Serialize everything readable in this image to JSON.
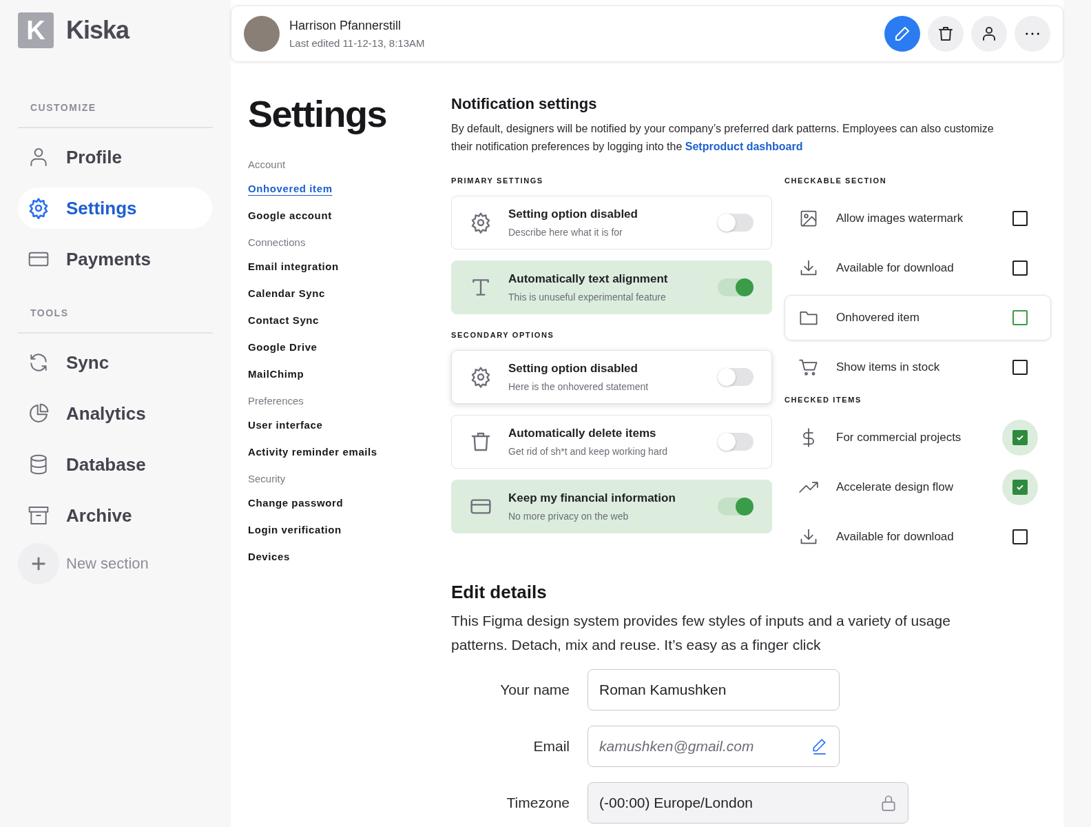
{
  "sidebar": {
    "logo_letter": "K",
    "brand": "Kiska",
    "sections": [
      {
        "title": "CUSTOMIZE",
        "items": [
          {
            "label": "Profile",
            "kind": "person",
            "selected": false
          },
          {
            "label": "Settings",
            "kind": "gear",
            "selected": true
          },
          {
            "label": "Payments",
            "kind": "card",
            "selected": false
          }
        ]
      },
      {
        "title": "TOOLS",
        "items": [
          {
            "label": "Sync",
            "kind": "sync",
            "selected": false
          },
          {
            "label": "Analytics",
            "kind": "pie",
            "selected": false
          },
          {
            "label": "Database",
            "kind": "database",
            "selected": false
          },
          {
            "label": "Archive",
            "kind": "archive",
            "selected": false
          }
        ]
      }
    ],
    "new_section": "New section"
  },
  "header": {
    "name": "Harrison Pfannerstill",
    "subtitle": "Last edited 11-12-13, 8:13AM",
    "actions": [
      {
        "kind": "edit",
        "selected": true
      },
      {
        "kind": "delete",
        "selected": false
      },
      {
        "kind": "person",
        "selected": false
      },
      {
        "kind": "more",
        "selected": false
      }
    ]
  },
  "settings_nav": {
    "title": "Settings",
    "groups": [
      {
        "heading": "Account",
        "items": [
          {
            "label": "Onhovered item",
            "selected": true
          },
          {
            "label": "Google account",
            "selected": false
          }
        ]
      },
      {
        "heading": "Connections",
        "items": [
          {
            "label": "Email integration",
            "selected": false
          },
          {
            "label": "Calendar Sync",
            "selected": false
          },
          {
            "label": "Contact Sync",
            "selected": false
          },
          {
            "label": "Google Drive",
            "selected": false
          },
          {
            "label": "MailChimp",
            "selected": false
          }
        ]
      },
      {
        "heading": "Preferences",
        "items": [
          {
            "label": "User interface",
            "selected": false
          },
          {
            "label": "Activity reminder emails",
            "selected": false
          }
        ]
      },
      {
        "heading": "Security",
        "items": [
          {
            "label": "Change password",
            "selected": false
          },
          {
            "label": "Login verification",
            "selected": false
          },
          {
            "label": "Devices",
            "selected": false
          }
        ]
      }
    ]
  },
  "notifications": {
    "title": "Notification settings",
    "description": "By default, designers will be notified by your company’s preferred dark patterns. Employees can also customize their notification preferences by logging into the",
    "link": "Setproduct dashboard",
    "toggle_groups": [
      {
        "heading": "PRIMARY SETTINGS",
        "items": [
          {
            "kind": "gear",
            "title": "Setting option disabled",
            "subtitle": "Describe here what it is for",
            "on": false,
            "hovered": false
          },
          {
            "kind": "text",
            "title": "Automatically text alignment",
            "subtitle": "This is unuseful experimental feature",
            "on": true,
            "hovered": false
          }
        ]
      },
      {
        "heading": "SECONDARY OPTIONS",
        "items": [
          {
            "kind": "gear",
            "title": "Setting option disabled",
            "subtitle": "Here is the onhovered statement",
            "on": false,
            "hovered": true
          },
          {
            "kind": "trash",
            "title": "Automatically delete items",
            "subtitle": "Get rid of sh*t and keep working hard",
            "on": false,
            "hovered": false
          },
          {
            "kind": "card",
            "title": "Keep my financial information",
            "subtitle": "No more privacy on the web",
            "on": true,
            "hovered": false
          }
        ]
      }
    ],
    "check_groups": [
      {
        "heading": "CHECKABLE SECTION",
        "items": [
          {
            "kind": "image",
            "label": "Allow images watermark",
            "checked": false,
            "hovered": false
          },
          {
            "kind": "download",
            "label": "Available for download",
            "checked": false,
            "hovered": false
          },
          {
            "kind": "folder",
            "label": "Onhovered item",
            "checked": false,
            "hovered": true
          },
          {
            "kind": "cart",
            "label": "Show items in stock",
            "checked": false,
            "hovered": false
          }
        ]
      },
      {
        "heading": "CHECKED ITEMS",
        "items": [
          {
            "kind": "dollar",
            "label": "For commercial projects",
            "checked": true,
            "hovered": false
          },
          {
            "kind": "trend",
            "label": "Accelerate design flow",
            "checked": true,
            "hovered": false
          },
          {
            "kind": "download",
            "label": "Available for download",
            "checked": false,
            "hovered": false
          }
        ]
      }
    ]
  },
  "edit_details": {
    "title": "Edit details",
    "description": "This Figma design system provides few styles of inputs and a variety of usage patterns. Detach, mix and reuse. It’s easy as a finger click",
    "fields": [
      {
        "kind": "text",
        "label": "Your name",
        "value": "Roman Kamushken"
      },
      {
        "kind": "email",
        "label": "Email",
        "placeholder": "kamushken@gmail.com"
      },
      {
        "kind": "locked",
        "label": "Timezone",
        "value": "(-00:00) Europe/London"
      }
    ]
  }
}
